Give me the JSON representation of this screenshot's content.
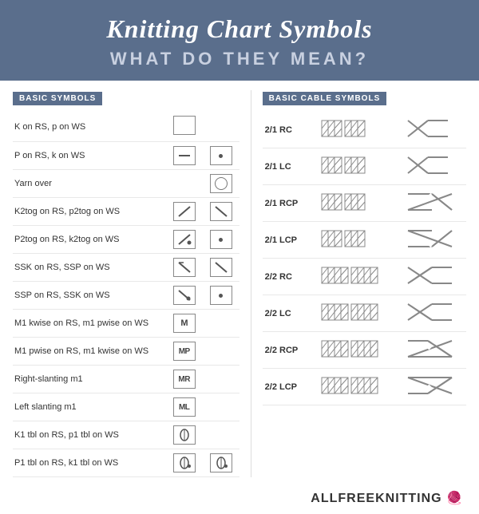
{
  "header": {
    "title": "Knitting Chart Symbols",
    "subtitle": "WHAT DO THEY MEAN?"
  },
  "left_section": {
    "header": "BASIC SYMBOLS",
    "rows": [
      {
        "label": "K on RS, p on WS",
        "symbol1": "empty_box",
        "symbol2": null
      },
      {
        "label": "P on RS, k on WS",
        "symbol1": "dash_box",
        "symbol2": "dot_box"
      },
      {
        "label": "Yarn over",
        "symbol1": null,
        "symbol2": "circle_sym"
      },
      {
        "label": "K2tog on RS, p2tog on WS",
        "symbol1": "rslash_box",
        "symbol2": "fslash_box"
      },
      {
        "label": "P2tog on RS, k2tog on WS",
        "symbol1": "rslash_dot_box",
        "symbol2": "dot_box2"
      },
      {
        "label": "SSK on RS, SSP on WS",
        "symbol1": "lslash_box",
        "symbol2": "lslash2_box"
      },
      {
        "label": "SSP on RS, SSK on WS",
        "symbol1": "lslash_dot_box",
        "symbol2": "dot_box3"
      },
      {
        "label": "M1 kwise on RS, m1 pwise on WS",
        "symbol1": "M_box",
        "symbol2": null
      },
      {
        "label": "M1 pwise on RS, m1 kwise on WS",
        "symbol1": "MP_box",
        "symbol2": null
      },
      {
        "label": "Right-slanting m1",
        "symbol1": "MR_box",
        "symbol2": null
      },
      {
        "label": "Left slanting m1",
        "symbol1": "ML_box",
        "symbol2": null
      },
      {
        "label": "K1 tbl on RS, p1 tbl on WS",
        "symbol1": "tbl1_box",
        "symbol2": null
      },
      {
        "label": "P1 tbl on RS, k1 tbl on WS",
        "symbol1": "tbl2_box",
        "symbol2": "tbl3_box"
      }
    ]
  },
  "right_section": {
    "header": "BASIC CABLE SYMBOLS",
    "rows": [
      {
        "label": "2/1 RC"
      },
      {
        "label": "2/1 LC"
      },
      {
        "label": "2/1 RCP"
      },
      {
        "label": "2/1 LCP"
      },
      {
        "label": "2/2 RC"
      },
      {
        "label": "2/2 LC"
      },
      {
        "label": "2/2 RCP"
      },
      {
        "label": "2/2 LCP"
      }
    ]
  },
  "footer": {
    "brand": "ALLFREEKNITTING"
  }
}
